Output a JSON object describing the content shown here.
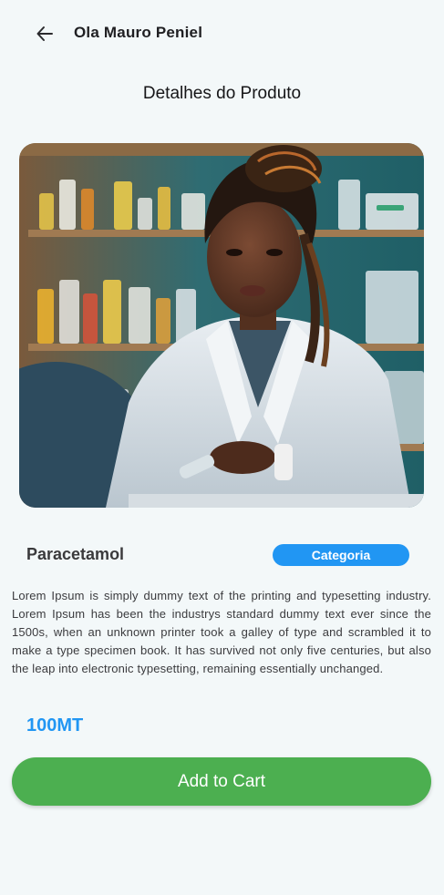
{
  "header": {
    "greeting": "Ola Mauro Peniel",
    "back_icon": "arrow-left-icon"
  },
  "page": {
    "title": "Detalhes do Produto"
  },
  "product": {
    "image_icon": "pharmacist-photo",
    "name": "Paracetamol",
    "category_label": "Categoria",
    "description": "Lorem Ipsum is simply dummy text of the printing and typesetting industry. Lorem Ipsum has been the industrys standard dummy text ever since the 1500s, when an unknown printer took a galley of type and scrambled it to make a type specimen book. It has survived not only five centuries, but also the leap into electronic typesetting, remaining essentially unchanged.",
    "price": "100MT"
  },
  "actions": {
    "add_to_cart_label": "Add to Cart"
  },
  "colors": {
    "accent_blue": "#2196f3",
    "cart_green": "#4caf50",
    "background": "#f3f8f9"
  }
}
